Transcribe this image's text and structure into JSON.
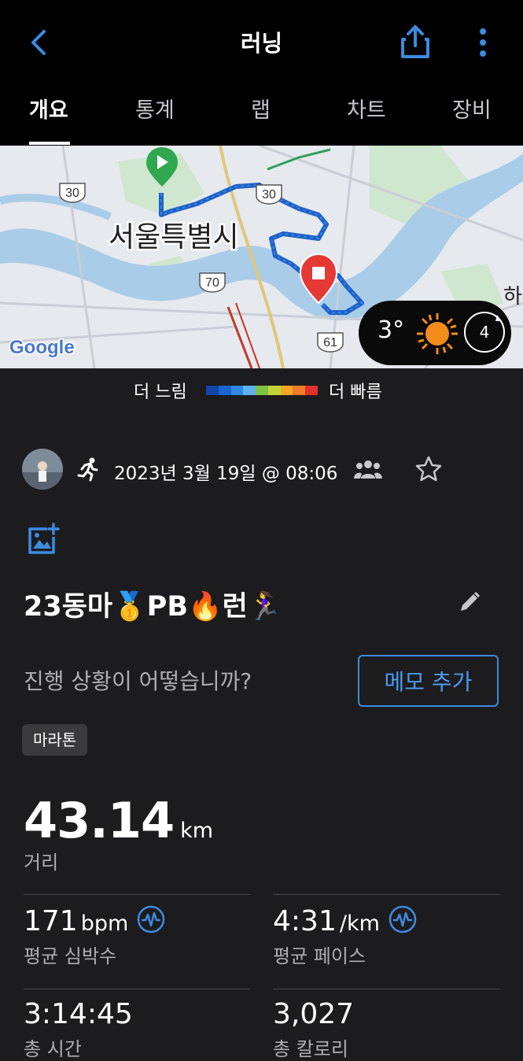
{
  "header": {
    "title": "러닝",
    "tabs": [
      {
        "label": "개요"
      },
      {
        "label": "통계"
      },
      {
        "label": "랩"
      },
      {
        "label": "차트"
      },
      {
        "label": "장비"
      }
    ]
  },
  "map": {
    "city_label": "서울특별시",
    "highway_labels": [
      "30",
      "30",
      "70",
      "61"
    ],
    "edge_label": "하",
    "attribution": "Google"
  },
  "weather": {
    "temperature": "3°",
    "icon": "sun-icon",
    "wind": "4"
  },
  "legend": {
    "slow_label": "더 느림",
    "fast_label": "더 빠름",
    "colors": [
      "#1344a8",
      "#1a66d0",
      "#2f88e0",
      "#5bb4f0",
      "#7dc241",
      "#bfd53a",
      "#f5a623",
      "#f07b2c",
      "#e0312a"
    ]
  },
  "activity": {
    "datetime": "2023년 3월 19일 @ 08:06",
    "title": "23동마🥇PB🔥런🏃‍♀️",
    "prompt": "진행 상황이 어떻습니까?",
    "memo_button": "메모 추가",
    "tag": "마라톤"
  },
  "stats": {
    "distance": {
      "value": "43.14",
      "unit": "km",
      "label": "거리"
    },
    "heart_rate": {
      "value": "171",
      "unit": "bpm",
      "label": "평균 심박수"
    },
    "pace": {
      "value": "4:31",
      "unit": "/km",
      "label": "평균 페이스"
    },
    "time": {
      "value": "3:14:45",
      "label": "총 시간"
    },
    "calories": {
      "value": "3,027",
      "label": "총 칼로리"
    }
  },
  "colors": {
    "accent": "#3c8be0",
    "start_pin": "#2fa84f",
    "end_pin": "#e53935",
    "route": "#1f5fc8"
  }
}
